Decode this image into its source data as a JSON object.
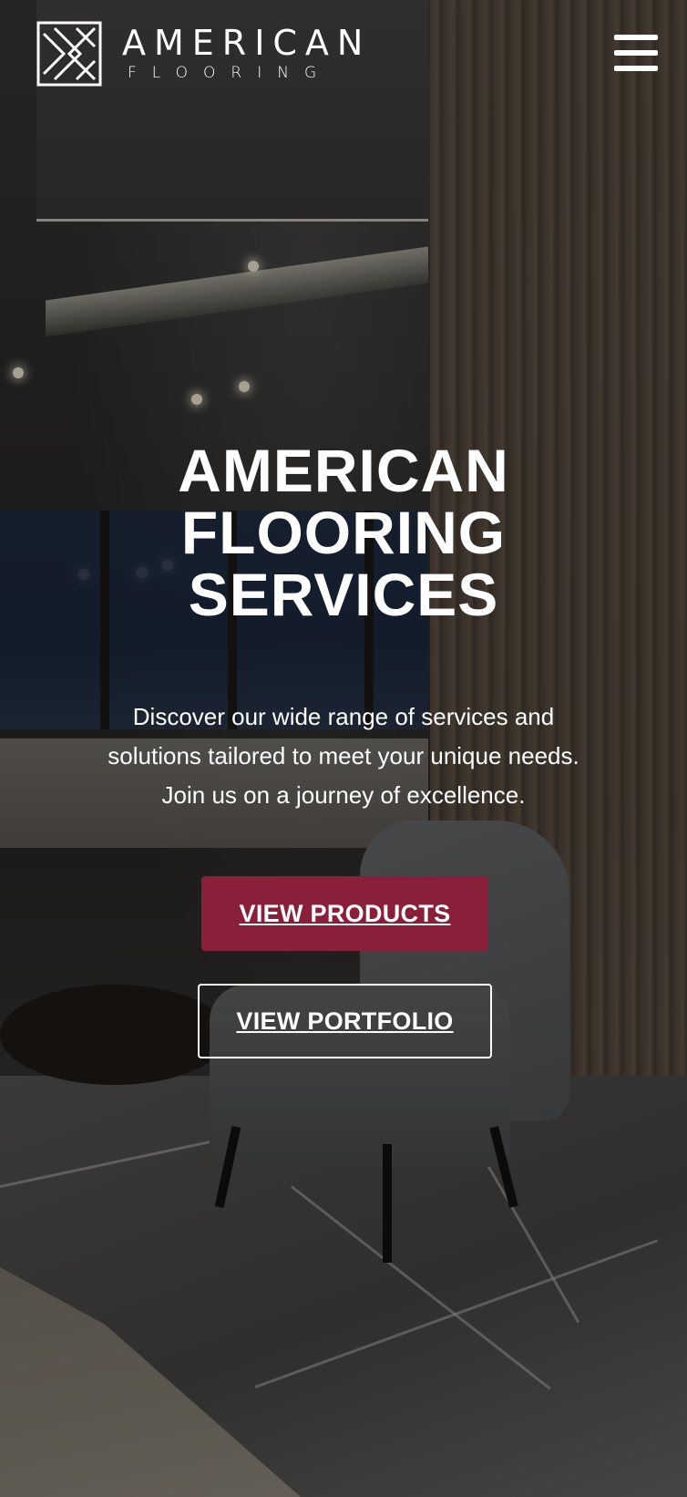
{
  "header": {
    "logo_word_1": "AMERICAN",
    "logo_word_2": "FLOORING",
    "logo_icon": "diamond-arrow-logo-icon",
    "menu_icon": "hamburger-menu-icon"
  },
  "hero": {
    "title_line_1": "AMERICAN",
    "title_line_2": "FLOORING",
    "title_line_3": "SERVICES",
    "subtitle_line_1": "Discover our wide range of services and",
    "subtitle_line_2": "solutions tailored to meet your unique needs.",
    "subtitle_line_3": "Join us on a journey of excellence.",
    "background": "interior-lounge-photo"
  },
  "actions": {
    "products_label": "VIEW PRODUCTS",
    "portfolio_label": "VIEW PORTFOLIO"
  },
  "colors": {
    "accent": "#8a1f39",
    "text": "#ffffff"
  }
}
